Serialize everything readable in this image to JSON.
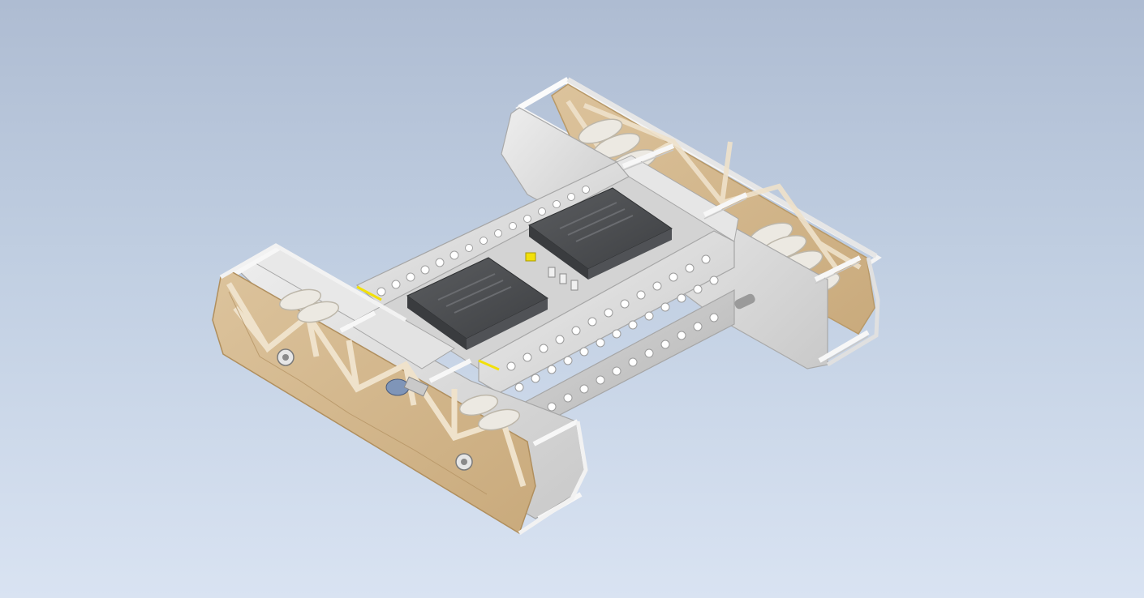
{
  "viewport": {
    "background_top": "#aebcd2",
    "background_bottom": "#d9e3f2"
  },
  "model": {
    "frame_color": "#dcdcdc",
    "panel_color": "#d2b58a",
    "battery_color": "#4b4d50",
    "accent_color": "#f2e00a",
    "wheel_color": "#e8e6e0",
    "icon": "robot-chassis-icon"
  }
}
